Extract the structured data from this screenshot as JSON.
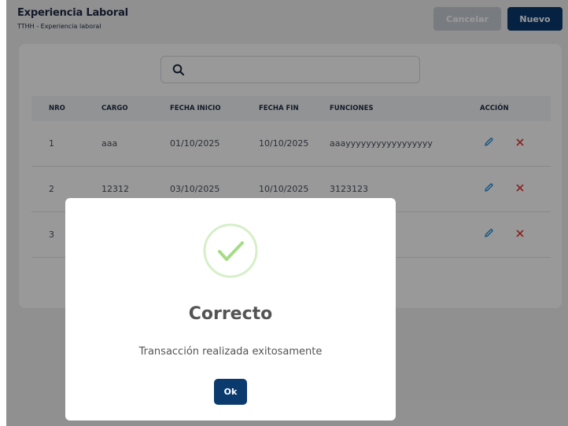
{
  "header": {
    "title": "Experiencia Laboral",
    "breadcrumb": "TTHH  - Experiencia laboral",
    "cancel_label": "Cancelar",
    "new_label": "Nuevo"
  },
  "search": {
    "value": "",
    "placeholder": ""
  },
  "table": {
    "columns": [
      "NRO",
      "CARGO",
      "FECHA INICIO",
      "FECHA FIN",
      "FUNCIONES",
      "ACCIÓN"
    ],
    "rows": [
      {
        "nro": "1",
        "cargo": "aaa",
        "fecha_inicio": "01/10/2025",
        "fecha_fin": "10/10/2025",
        "funciones": "aaayyyyyyyyyyyyyyyyy"
      },
      {
        "nro": "2",
        "cargo": "12312",
        "fecha_inicio": "03/10/2025",
        "fecha_fin": "10/10/2025",
        "funciones": "3123123"
      },
      {
        "nro": "3",
        "cargo": "",
        "fecha_inicio": "",
        "fecha_fin": "",
        "funciones": ""
      }
    ],
    "action_icons": [
      "pencil-icon",
      "close-icon"
    ]
  },
  "modal": {
    "title": "Correcto",
    "message": "Transacción realizada exitosamente",
    "ok_label": "Ok",
    "icon": "check-circle-icon"
  },
  "colors": {
    "primary": "#0b3a6e",
    "cancel_button": "#c9ced6",
    "edit_icon": "#1e8ad8",
    "delete_icon": "#e53935",
    "success": "#a5dc86"
  }
}
